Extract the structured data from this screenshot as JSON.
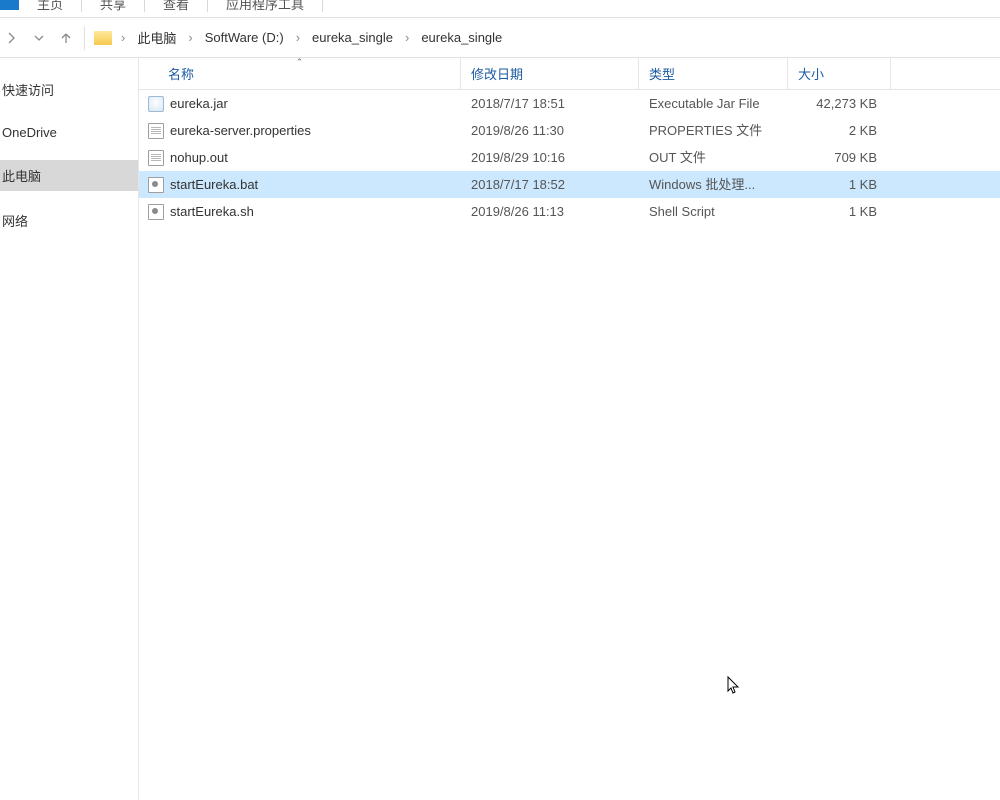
{
  "ribbon": {
    "tabs": [
      "主页",
      "共享",
      "查看",
      "应用程序工具"
    ]
  },
  "breadcrumb": [
    "此电脑",
    "SoftWare (D:)",
    "eureka_single",
    "eureka_single"
  ],
  "columns": {
    "name": "名称",
    "date": "修改日期",
    "type": "类型",
    "size": "大小"
  },
  "sidebar": {
    "items": [
      {
        "label": "快速访问",
        "sel": false
      },
      {
        "label": "OneDrive",
        "sel": false
      },
      {
        "label": "此电脑",
        "sel": true
      },
      {
        "label": "网络",
        "sel": false
      }
    ]
  },
  "files": [
    {
      "icon": "jar",
      "name": "eureka.jar",
      "date": "2018/7/17 18:51",
      "type": "Executable Jar File",
      "size": "42,273 KB",
      "state": ""
    },
    {
      "icon": "txt",
      "name": "eureka-server.properties",
      "date": "2019/8/26 11:30",
      "type": "PROPERTIES 文件",
      "size": "2 KB",
      "state": ""
    },
    {
      "icon": "txt",
      "name": "nohup.out",
      "date": "2019/8/29 10:16",
      "type": "OUT 文件",
      "size": "709 KB",
      "state": ""
    },
    {
      "icon": "bat",
      "name": "startEureka.bat",
      "date": "2018/7/17 18:52",
      "type": "Windows 批处理...",
      "size": "1 KB",
      "state": "sel"
    },
    {
      "icon": "bat",
      "name": "startEureka.sh",
      "date": "2019/8/26 11:13",
      "type": "Shell Script",
      "size": "1 KB",
      "state": ""
    }
  ]
}
